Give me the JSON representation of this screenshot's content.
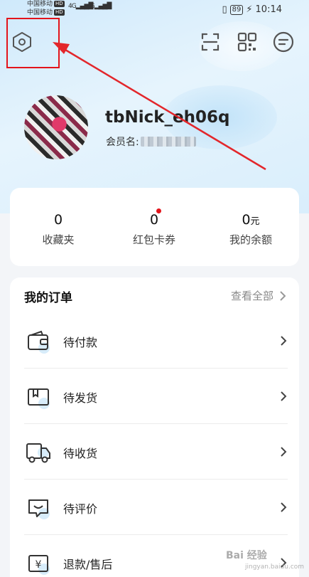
{
  "status_bar": {
    "carrier_1": "中国移动",
    "carrier_2": "中国移动",
    "hd": "HD",
    "signal": "4G",
    "battery": "89",
    "time": "10:14"
  },
  "header": {
    "settings_icon": "hexagon-settings-icon",
    "scan_icon": "scan-icon",
    "qr_icon": "qrcode-icon",
    "message_icon": "message-icon"
  },
  "profile": {
    "username": "tbNick_eh06q",
    "member_label": "会员名:"
  },
  "stats": [
    {
      "value": "0",
      "unit": "",
      "label": "收藏夹"
    },
    {
      "value": "0",
      "unit": "",
      "label": "红包卡券"
    },
    {
      "value": "0",
      "unit": "元",
      "label": "我的余额"
    }
  ],
  "orders": {
    "title": "我的订单",
    "view_all": "查看全部",
    "items": [
      {
        "label": "待付款",
        "icon": "wallet-icon"
      },
      {
        "label": "待发货",
        "icon": "package-icon"
      },
      {
        "label": "待收货",
        "icon": "truck-icon"
      },
      {
        "label": "待评价",
        "icon": "comment-icon"
      },
      {
        "label": "退款/售后",
        "icon": "refund-icon"
      }
    ]
  },
  "watermark": {
    "text": "Bai 经验",
    "sub": "jingyan.baidu.com"
  },
  "colors": {
    "accent": "#e3141b",
    "header_bg": "#d6edfc",
    "page_bg": "#f3f5f8"
  }
}
